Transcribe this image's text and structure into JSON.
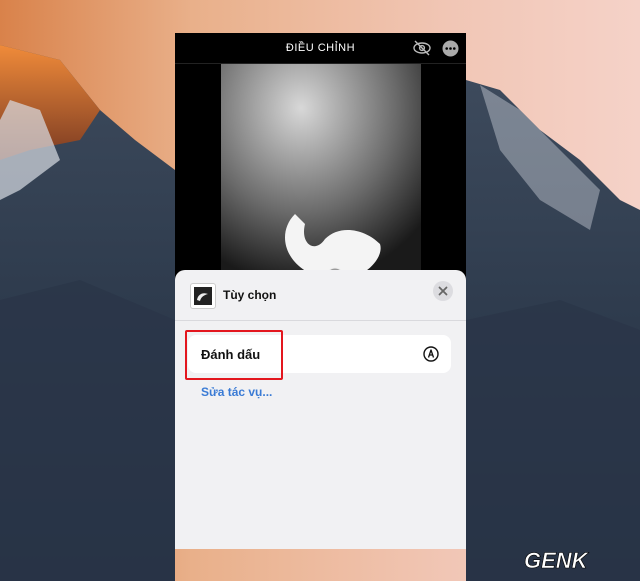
{
  "header": {
    "title": "ĐIỀU CHỈNH"
  },
  "sheet": {
    "title": "Tùy chọn",
    "action_label": "Đánh dấu",
    "edit_link": "Sửa tác vụ..."
  },
  "watermark": {
    "text": "GENK"
  },
  "icons": {
    "hide": "eye-slash-icon",
    "more": "ellipsis-circle-icon",
    "close": "close-icon",
    "markup": "markup-pen-icon"
  },
  "colors": {
    "highlight": "#e3161e",
    "link": "#3a7bd5",
    "sheet_bg": "#f1f1f3"
  }
}
